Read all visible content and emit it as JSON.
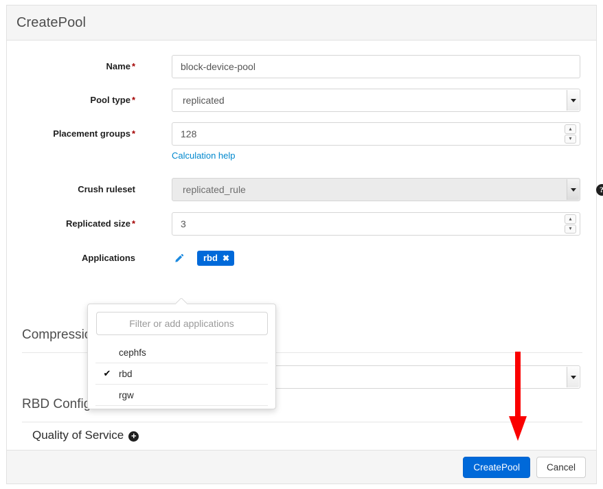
{
  "dialog": {
    "title": "CreatePool"
  },
  "form": {
    "name": {
      "label": "Name",
      "required": true,
      "value": "block-device-pool"
    },
    "pool_type": {
      "label": "Pool type",
      "required": true,
      "value": "replicated"
    },
    "placement_groups": {
      "label": "Placement groups",
      "required": true,
      "value": "128",
      "helper_link": "Calculation help"
    },
    "crush_ruleset": {
      "label": "Crush ruleset",
      "required": false,
      "value": "replicated_rule",
      "disabled": true,
      "help_icon": "question-mark-icon"
    },
    "replicated_size": {
      "label": "Replicated size",
      "required": true,
      "value": "3"
    },
    "applications": {
      "label": "Applications",
      "edit_icon": "pencil-icon",
      "selected": [
        {
          "name": "rbd",
          "remove_icon": "close-icon"
        }
      ]
    }
  },
  "applications_dropdown": {
    "filter_placeholder": "Filter or add applications",
    "filter_value": "",
    "options": [
      {
        "label": "cephfs",
        "checked": false
      },
      {
        "label": "rbd",
        "checked": true
      },
      {
        "label": "rgw",
        "checked": false
      }
    ],
    "check_glyph": "✔"
  },
  "sections": {
    "compression": {
      "title": "Compression",
      "mode_value": ""
    },
    "rbd_configuration": {
      "title": "RBD Configuration",
      "quality_of_service": {
        "title": "Quality of Service",
        "expand_icon": "plus-circle-icon",
        "expand_glyph": "+"
      }
    }
  },
  "footer": {
    "submit_label": "CreatePool",
    "cancel_label": "Cancel"
  },
  "annotation": {
    "arrow": "red-down-arrow",
    "color": "#fa0000"
  },
  "colors": {
    "accent": "#0069d9",
    "link": "#0088ce",
    "required": "#a30000",
    "header_bg": "#f5f5f5"
  }
}
